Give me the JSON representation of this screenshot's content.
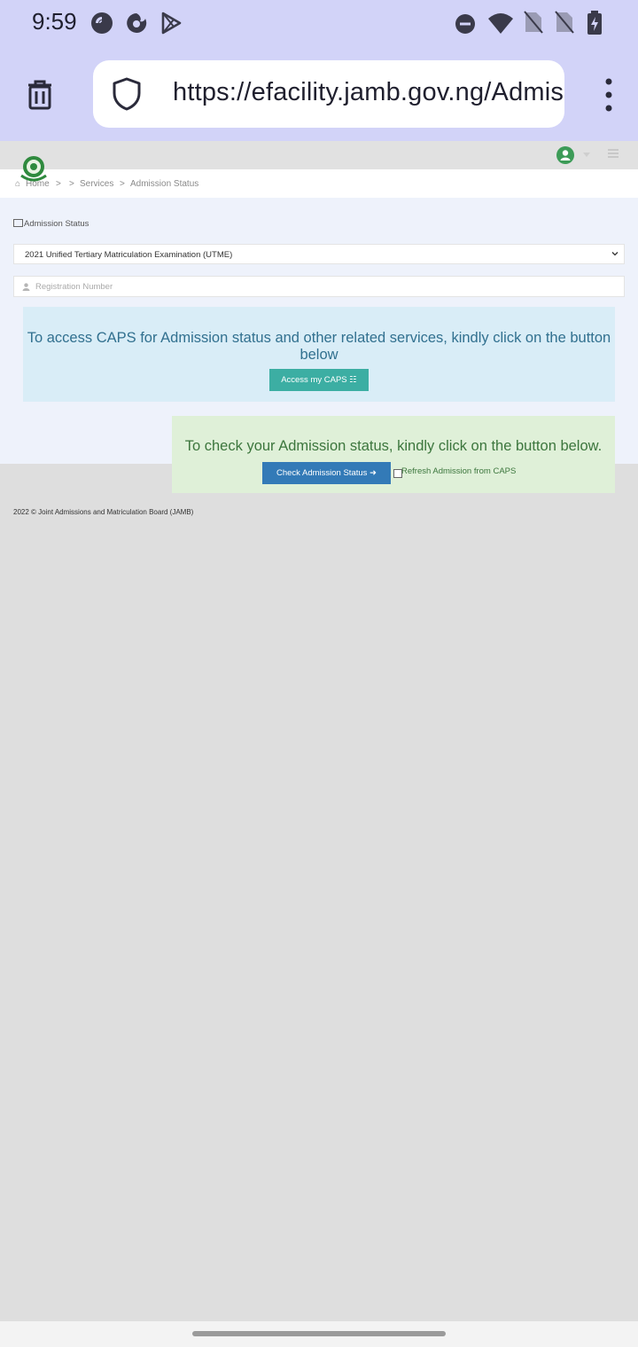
{
  "status_bar": {
    "time": "9:59",
    "notification_icons": [
      "pocket-casts-icon",
      "firefox-icon",
      "play-store-icon"
    ],
    "system_icons": [
      "do-not-disturb-icon",
      "wifi-icon",
      "no-sim-icon",
      "no-sim-icon",
      "battery-charging-icon"
    ]
  },
  "browser": {
    "url": "https://efacility.jamb.gov.ng/AdmissionStatus",
    "icons": [
      "trash-icon",
      "shield-icon",
      "more-vert-icon"
    ]
  },
  "header": {
    "icons": [
      "jamb-logo",
      "user-icon",
      "hamburger-icon"
    ]
  },
  "breadcrumb": {
    "home": "Home",
    "sep1": ">",
    "sep2": ">",
    "services": "Services",
    "sep3": ">",
    "current": "Admission Status"
  },
  "form": {
    "section_title": "Admission Status",
    "exam_selected": "2021 Unified Tertiary Matriculation Examination (UTME)",
    "reg_placeholder": "Registration Number"
  },
  "caps_alert": {
    "text": "To access CAPS for Admission status and other related services, kindly click on the button below",
    "button_label": "Access my CAPS"
  },
  "status_alert": {
    "text": "To check your Admission status, kindly click on the button below.",
    "button_label": "Check Admission Status",
    "checkbox_label": "Refresh Admission from CAPS",
    "checkbox_checked": false
  },
  "footer": {
    "copyright": "2022 © Joint Admissions and Matriculation Board (JAMB)"
  },
  "colors": {
    "chrome_bg": "#d2d3f8",
    "info_bg": "#d9edf7",
    "info_text": "#31708f",
    "success_bg": "#dff0d8",
    "success_text": "#3c763d",
    "teal_button": "#3caea3",
    "blue_button": "#337ab7"
  }
}
